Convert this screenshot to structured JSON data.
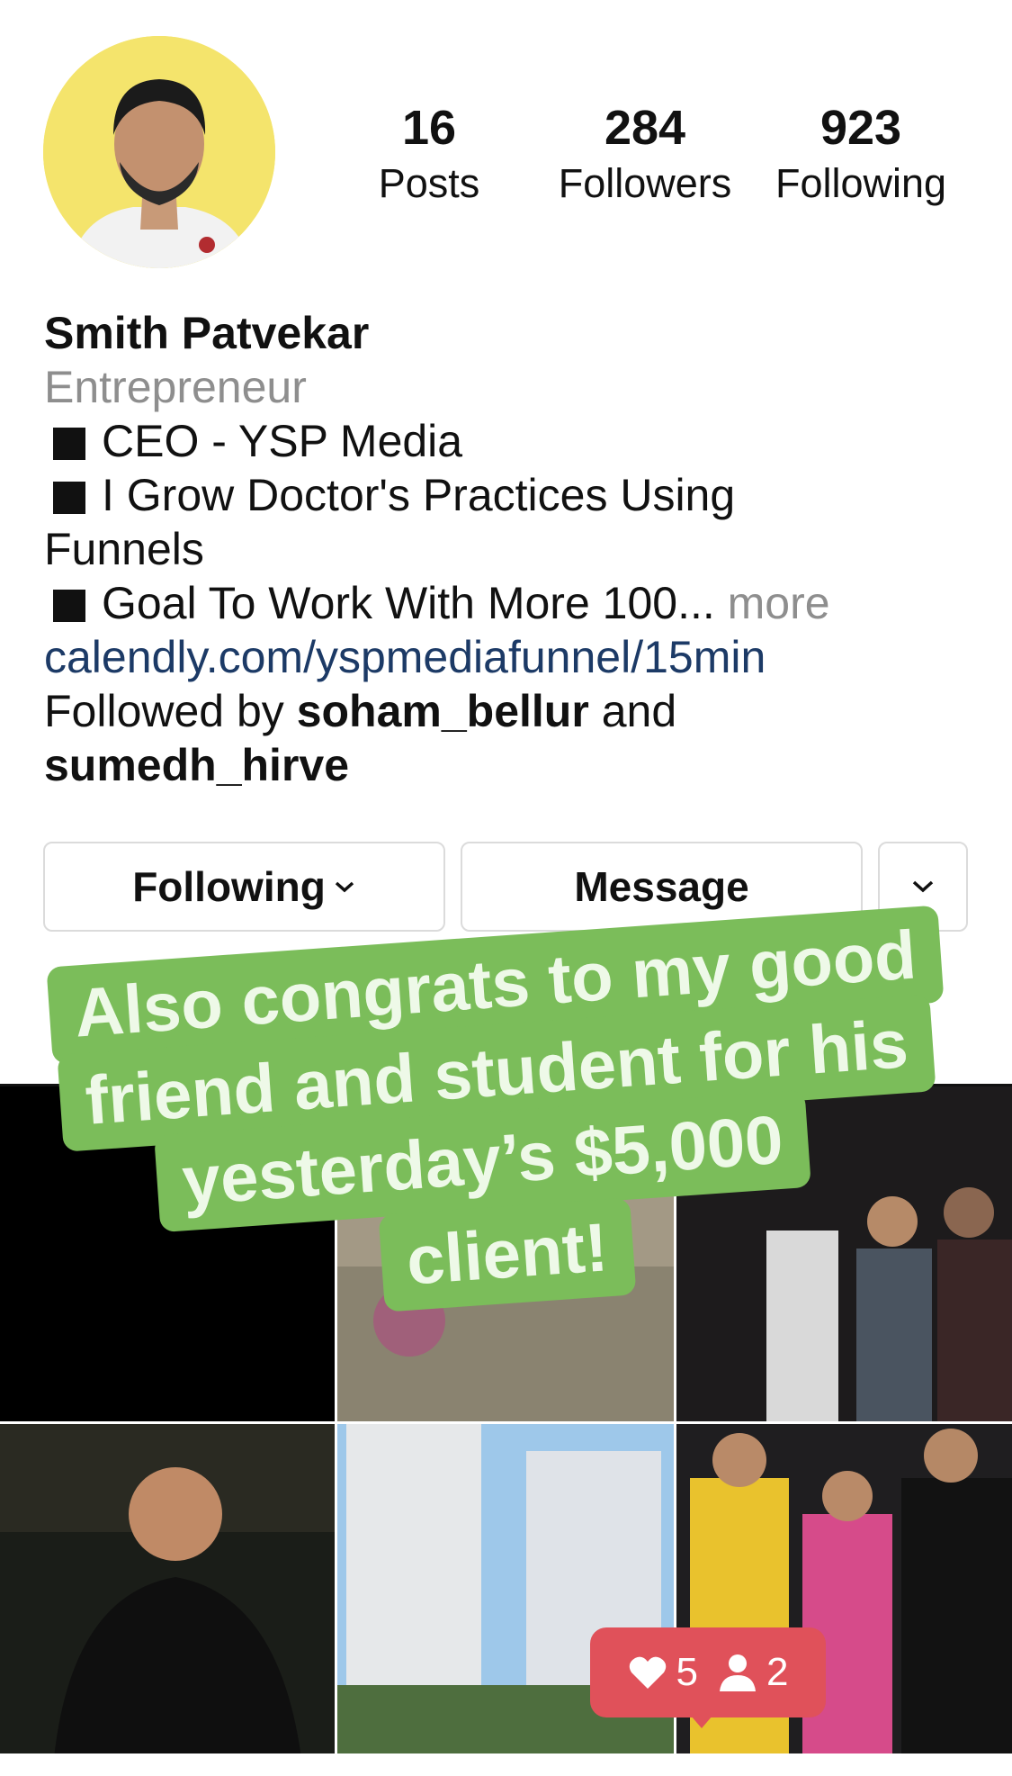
{
  "profile": {
    "name": "Smith Patvekar",
    "category": "Entrepreneur",
    "bio_lines": [
      "CEO - YSP Media",
      "I Grow Doctor's Practices Using Funnels",
      "Goal To Work With More 100..."
    ],
    "more_label": "more",
    "link": "calendly.com/yspmediafunnel/15min",
    "followed_by_prefix": "Followed by",
    "followed_by_user1": "soham_bellur",
    "followed_by_and": "and",
    "followed_by_user2": "sumedh_hirve"
  },
  "stats": {
    "posts": {
      "value": "16",
      "label": "Posts"
    },
    "followers": {
      "value": "284",
      "label": "Followers"
    },
    "following": {
      "value": "923",
      "label": "Following"
    }
  },
  "actions": {
    "following_label": "Following",
    "message_label": "Message"
  },
  "sticker": {
    "lines": [
      "Also congrats to my good",
      "friend and student for his",
      "yesterday’s $5,000",
      "client!"
    ]
  },
  "notification": {
    "likes": "5",
    "follows": "2"
  },
  "colors": {
    "avatar_bg": "#f4e46c",
    "sticker_green": "#7bbd5a",
    "link_blue": "#1c3a66",
    "notification_red": "#e0515a"
  }
}
